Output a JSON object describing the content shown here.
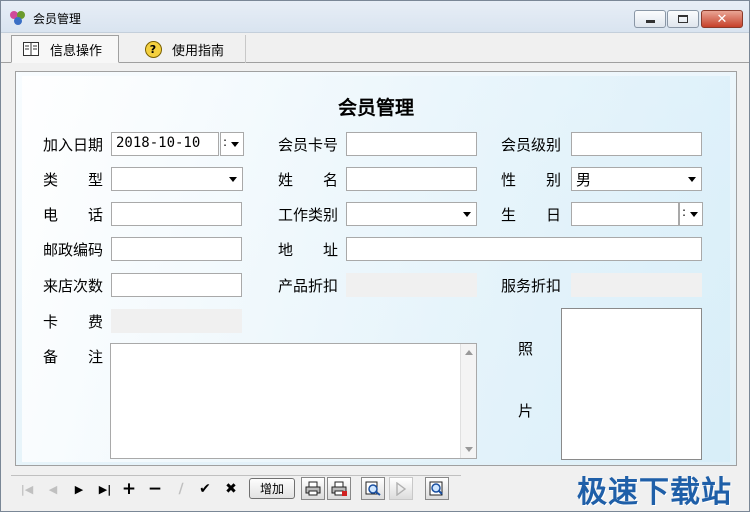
{
  "window": {
    "title": "会员管理"
  },
  "tabs": [
    {
      "label": "信息操作",
      "active": true
    },
    {
      "label": "使用指南",
      "active": false
    }
  ],
  "form": {
    "title": "会员管理",
    "labels": {
      "join_date": "加入日期",
      "card_no": "会员卡号",
      "level": "会员级别",
      "type": "类　　型",
      "name": "姓　　名",
      "gender": "性　　别",
      "phone": "电　　话",
      "job_type": "工作类别",
      "birthday": "生　　日",
      "zip": "邮政编码",
      "address": "地　　址",
      "visits": "来店次数",
      "product_discount": "产品折扣",
      "service_discount": "服务折扣",
      "fee": "卡　　费",
      "remark": "备　　注",
      "photo_1": "照",
      "photo_2": "片"
    },
    "values": {
      "join_date": "2018-10-10",
      "card_no": "",
      "level": "",
      "type": "",
      "name": "",
      "gender": "男",
      "phone": "",
      "job_type": "",
      "birthday": "",
      "zip": "",
      "address": "",
      "visits": "",
      "product_discount": "",
      "service_discount": "",
      "fee": "",
      "remark": ""
    }
  },
  "toolbar": {
    "nav_first": "|◀",
    "nav_prev": "◀",
    "nav_next": "▶",
    "nav_last": "▶|",
    "add": "+",
    "remove": "−",
    "edit": "∕",
    "confirm": "✔",
    "cancel": "✖",
    "add_button_label": "增加"
  },
  "watermark": "极速下载站",
  "colors": {
    "title_bar": "#dfe8f2",
    "close_button": "#c6412a",
    "panel_bg": "#e6f3fa",
    "watermark": "#1f5fa8"
  }
}
